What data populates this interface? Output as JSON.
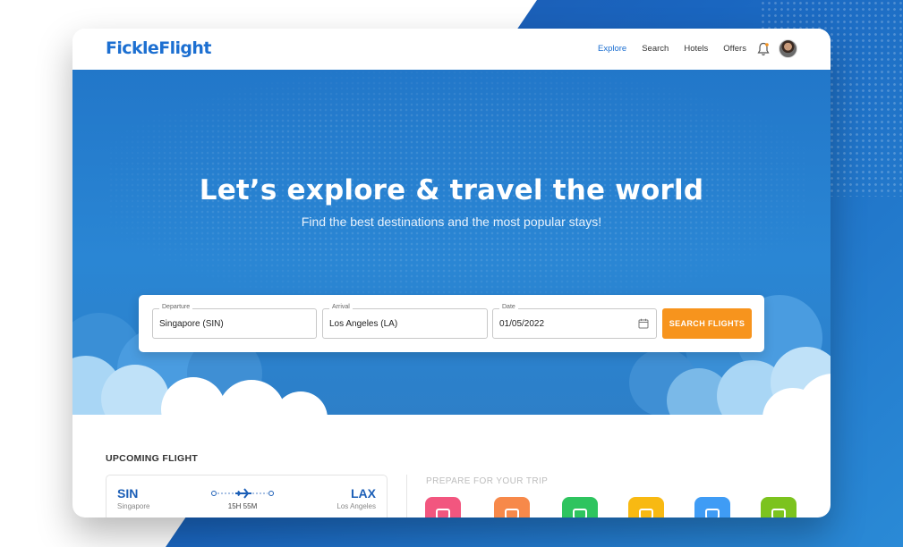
{
  "brand": {
    "logo": "FickleFlight",
    "accent": "#1c6fd1",
    "cta_color": "#f7941d"
  },
  "nav": {
    "items": [
      {
        "label": "Explore",
        "active": true
      },
      {
        "label": "Search",
        "active": false
      },
      {
        "label": "Hotels",
        "active": false
      },
      {
        "label": "Offers",
        "active": false
      }
    ]
  },
  "hero": {
    "title": "Let’s explore & travel the world",
    "subtitle": "Find the best destinations and the most popular stays!"
  },
  "search": {
    "departure": {
      "label": "Departure",
      "value": "Singapore (SIN)"
    },
    "arrival": {
      "label": "Arrival",
      "value": "Los Angeles (LA)"
    },
    "date": {
      "label": "Date",
      "value": "01/05/2022"
    },
    "button": "SEARCH FLIGHTS"
  },
  "upcoming": {
    "title": "UPCOMING FLIGHT",
    "from_code": "SIN",
    "from_city": "Singapore",
    "to_code": "LAX",
    "to_city": "Los Angeles",
    "duration": "15H 55M"
  },
  "prepare": {
    "title": "PREPARE FOR YOUR TRIP",
    "icons": [
      {
        "name": "luggage-icon",
        "color": "#f2567f"
      },
      {
        "name": "ticket-icon",
        "color": "#f7894a"
      },
      {
        "name": "restaurant-icon",
        "color": "#2ec45f"
      },
      {
        "name": "train-icon",
        "color": "#f8b912"
      },
      {
        "name": "car-icon",
        "color": "#3f9cf5"
      },
      {
        "name": "movie-icon",
        "color": "#7cc31e"
      }
    ]
  }
}
